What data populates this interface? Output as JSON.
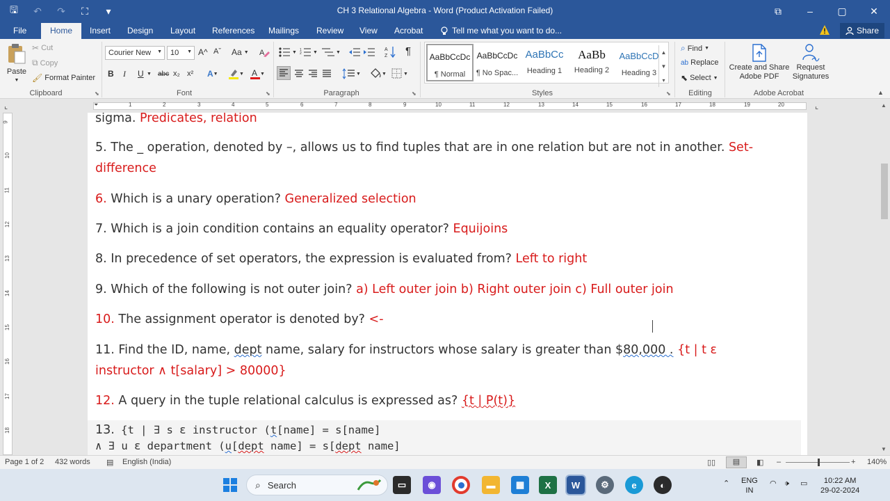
{
  "window": {
    "title": "CH 3 Relational Algebra - Word (Product Activation Failed)",
    "controls": {
      "minimize": "–",
      "maximize": "▢",
      "close": "✕",
      "ribbon_display": "⧉"
    }
  },
  "quick_access": {
    "save": "🖫",
    "undo": "↶",
    "redo": "↷",
    "touch": "⛶",
    "customize": "▾"
  },
  "tabs": [
    {
      "label": "File"
    },
    {
      "label": "Home",
      "active": true
    },
    {
      "label": "Insert"
    },
    {
      "label": "Design"
    },
    {
      "label": "Layout"
    },
    {
      "label": "References"
    },
    {
      "label": "Mailings"
    },
    {
      "label": "Review"
    },
    {
      "label": "View"
    },
    {
      "label": "Acrobat"
    }
  ],
  "tell_me": {
    "placeholder": "Tell me what you want to do...",
    "icon": "lightbulb-icon"
  },
  "share": {
    "label": "Share",
    "icon": "person-icon"
  },
  "ribbon": {
    "clipboard": {
      "paste": "Paste",
      "cut": "Cut",
      "copy": "Copy",
      "format_painter": "Format Painter",
      "label": "Clipboard"
    },
    "font": {
      "name": "Courier New",
      "size": "10",
      "bold": "B",
      "italic": "I",
      "underline": "U",
      "strike": "abc",
      "subscript": "x₂",
      "superscript": "x²",
      "grow": "A^",
      "shrink": "Aˇ",
      "case": "Aa",
      "label": "Font"
    },
    "paragraph": {
      "label": "Paragraph",
      "pilcrow": "¶"
    },
    "styles": {
      "items": [
        {
          "preview": "AaBbCcDc",
          "name": "¶ Normal"
        },
        {
          "preview": "AaBbCcDc",
          "name": "¶ No Spac..."
        },
        {
          "preview": "AaBbCc",
          "name": "Heading 1"
        },
        {
          "preview": "AaBb",
          "name": "Heading 2"
        },
        {
          "preview": "AaBbCcD",
          "name": "Heading 3"
        }
      ],
      "label": "Styles"
    },
    "editing": {
      "find": "Find",
      "replace": "Replace",
      "select": "Select",
      "label": "Editing"
    },
    "acrobat": {
      "create_share": "Create and Share",
      "adobe_pdf": "Adobe PDF",
      "request": "Request",
      "signatures": "Signatures",
      "label": "Adobe Acrobat"
    }
  },
  "ruler": {
    "numbers": [
      "1",
      "1",
      "2",
      "3",
      "4",
      "5",
      "6",
      "7",
      "8",
      "9",
      "10",
      "11",
      "12",
      "13",
      "14",
      "15",
      "16",
      "17",
      "18",
      "19",
      "20"
    ]
  },
  "vruler": {
    "numbers": [
      "9",
      "10",
      "11",
      "12",
      "13",
      "14",
      "15",
      "16",
      "17",
      "18"
    ]
  },
  "document": {
    "p0": {
      "text": "sigma. ",
      "answer": "Predicates, relation"
    },
    "p5": {
      "line1_text": "5. The _ operation, denoted by –, allows us to find tuples that are in one relation but are not in another. ",
      "line1_answer": "Set-",
      "line2_answer": "difference"
    },
    "p6": {
      "num": "6.",
      "text": " Which is a unary operation? ",
      "answer": "Generalized selection"
    },
    "p7": {
      "text": "7. Which is a join condition contains an equality operator? ",
      "answer": "Equijoins"
    },
    "p8": {
      "text": "8. In precedence of set operators, the expression is evaluated from? ",
      "answer": "Left to right"
    },
    "p9": {
      "text": "9. Which of the following is not outer join? ",
      "answer": "a) Left outer join b) Right outer join c) Full outer join"
    },
    "p10": {
      "num": "10.",
      "text": " The assignment operator is denoted by? ",
      "answer": " <-"
    },
    "p11": {
      "a": "11. Find the ID, name, ",
      "b": "dept",
      "c": " name, salary for instructors whose salary is greater than $",
      "d": "80,000 .",
      "answer1": " {t | t ε",
      "answer2": "instructor ∧ t[salary] > 80000}"
    },
    "p12": {
      "num": "12.",
      "text": " A query in the tuple relational calculus is expressed as? ",
      "answer": "{t | P(t)}"
    },
    "p13": {
      "num": "13.",
      "line1_a": " {t | ∃ s ε instructor (",
      "line1_b": "t",
      "line1_c": "[name] = s[name]",
      "line2_a": "∧ ∃ u ε department (",
      "line2_b": "u",
      "line2_c": "[",
      "line2_d": "dept",
      "line2_e": " name] = s[",
      "line2_f": "dept",
      "line2_g": " name]"
    }
  },
  "status": {
    "page": "Page 1 of 2",
    "words": "432 words",
    "language": "English (India)",
    "zoom": "140%",
    "zoom_minus": "–",
    "zoom_plus": "+"
  },
  "taskbar": {
    "search": "Search",
    "lang1": "ENG",
    "lang2": "IN",
    "time": "10:22 AM",
    "date": "29-02-2024"
  },
  "colors": {
    "word_blue": "#2b579a",
    "answer_red": "#d81b1b",
    "body_text": "#333333"
  }
}
